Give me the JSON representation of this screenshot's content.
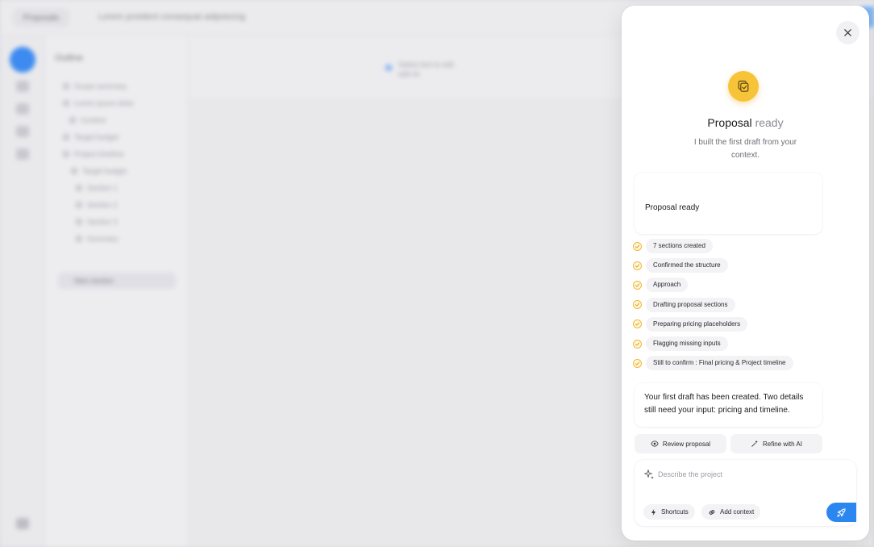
{
  "background": {
    "back_button": "Proposals",
    "doc_title": "Lorem proident consequat adipisicing",
    "outline_title": "Outline",
    "outline_items": [
      "Scope summary",
      "Lorem ipsum dolor",
      "Context",
      "Target budget",
      "Project timeline",
      "Target budget",
      "Section 1",
      "Section 2",
      "Section 3",
      "Summary"
    ],
    "outline_button": "New section",
    "main_chip_line1": "Select text to edit",
    "main_chip_line2": "with AI"
  },
  "panel": {
    "close_icon": "x-icon",
    "hero_icon": "document-check-icon",
    "title_main": "Proposal",
    "title_muted": "ready",
    "subtitle": "I built the first draft from your context.",
    "card_title": "Proposal ready",
    "steps": [
      "7 sections created",
      "Confirmed the structure",
      "Approach",
      "Drafting proposal sections",
      "Preparing pricing placeholders",
      "Flagging missing inputs",
      "Still to confirm : Final pricing & Project timeline"
    ],
    "message": "Your first draft has been created. Two details still need your input: pricing and timeline.",
    "review_label": "Review proposal",
    "refine_label": "Refine with AI",
    "composer": {
      "value": "",
      "placeholder": "Describe the project",
      "shortcuts_label": "Shortcuts",
      "add_context_label": "Add context"
    }
  },
  "colors": {
    "accent_yellow": "#f7c339",
    "primary_blue": "#2b86f0",
    "check_stroke": "#f2b733"
  }
}
